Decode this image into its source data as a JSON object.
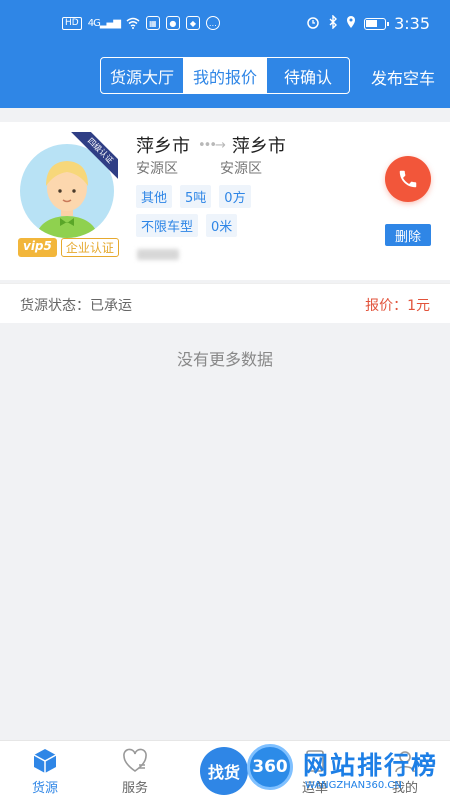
{
  "status_bar": {
    "hd": "HD",
    "network": "4G",
    "time": "3:35"
  },
  "header": {
    "tabs": [
      {
        "label": "货源大厅"
      },
      {
        "label": "我的报价"
      },
      {
        "label": "待确认"
      }
    ],
    "active_tab": "我的报价",
    "publish_label": "发布空车"
  },
  "card": {
    "ribbon_text": "四级认证",
    "vip_label": "vip5",
    "cert_label": "企业认证",
    "from_city": "萍乡市",
    "from_district": "安源区",
    "to_city": "萍乡市",
    "to_district": "安源区",
    "tags_row1": [
      "其他",
      "5吨",
      "0方"
    ],
    "tags_row2": [
      "不限车型",
      "0米"
    ],
    "delete_label": "删除"
  },
  "status_row": {
    "status_label": "货源状态：",
    "status_value": "已承运",
    "price_label": "报价：",
    "price_value": "1元"
  },
  "empty_text": "没有更多数据",
  "bottom_nav": {
    "items": [
      {
        "label": "货源",
        "icon": "box-icon"
      },
      {
        "label": "服务",
        "icon": "heart-icon"
      },
      {
        "label": "运单",
        "icon": "waybill-icon"
      },
      {
        "label": "我的",
        "icon": "user-icon"
      }
    ],
    "find_label": "找货"
  },
  "watermark": {
    "badge": "360",
    "text": "网站排行榜",
    "sub": "WANGZHAN360.CN"
  },
  "colors": {
    "primary": "#2f86e6",
    "call_button": "#f2563a",
    "price": "#e2533b",
    "vip": "#f2b63b"
  }
}
